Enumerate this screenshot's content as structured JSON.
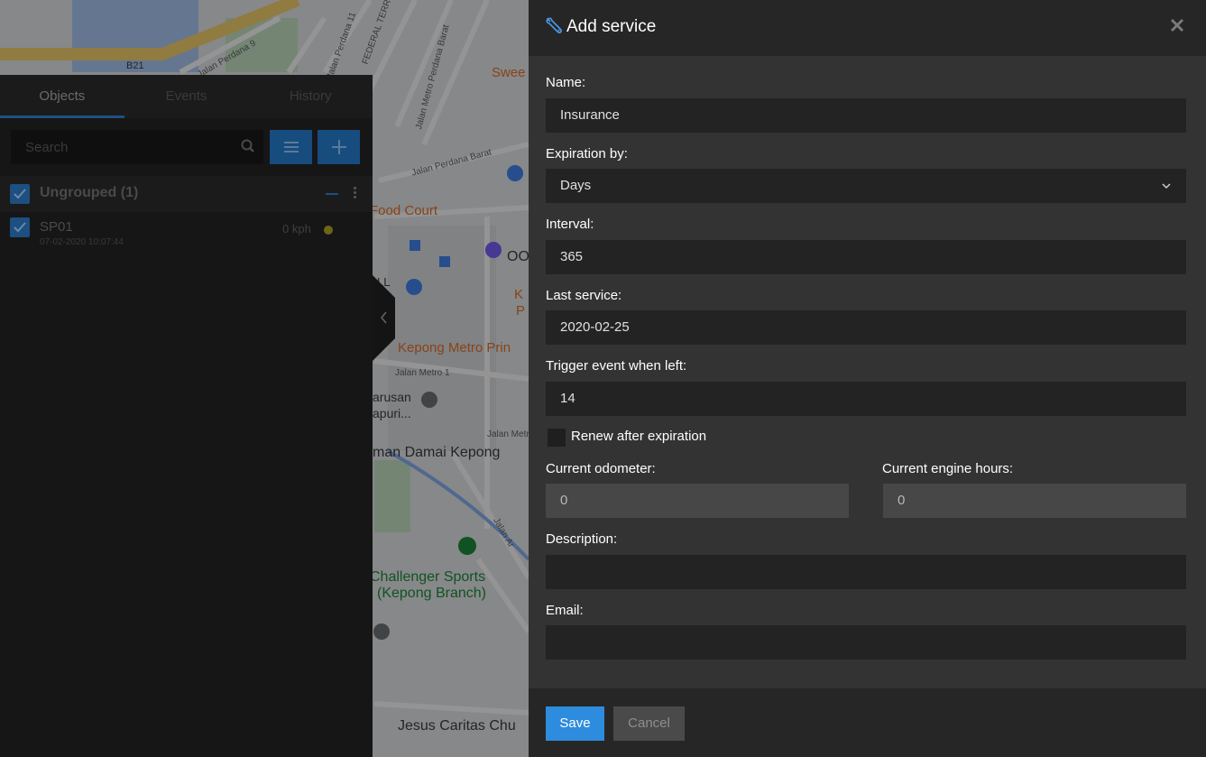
{
  "map": {
    "labels": {
      "road_b21": "B21",
      "perdana9": "Jalan Perdana 9",
      "perdana11": "Jalan Perdana 11",
      "perdana13": "Jalan Perdana 13",
      "federal": "FEDERAL TERR",
      "metro_perdana": "Jalan Metro Perdana Barat",
      "perdana_barat": "Jalan Perdana Barat",
      "sweet": "Swee",
      "food_court": "Food Court",
      "oo": "OO",
      "k": "K",
      "p": "P",
      "ll": "LL",
      "kepong_metro": "Kepong Metro Prin",
      "jalan_metro1": "Jalan Metro 1",
      "jarusan": "arusan",
      "apuri": "apuri...",
      "jalan_metro": "Jalan Metro",
      "taman_damai": "man Damai Kepong",
      "jalan_ar": "Jalan Ar",
      "challenger": "Challenger Sports",
      "kepong_branch": "(Kepong Branch)",
      "jesus": "Jesus Caritas Chu"
    }
  },
  "left_panel": {
    "tabs": [
      "Objects",
      "Events",
      "History"
    ],
    "search_placeholder": "Search",
    "group_label": "Ungrouped (1)",
    "object": {
      "name": "SP01",
      "time": "07-02-2020 10:07:44",
      "speed": "0 kph",
      "status_color": "#e0c020"
    }
  },
  "modal": {
    "title": "Add service",
    "fields": {
      "name": {
        "label": "Name:",
        "value": "Insurance"
      },
      "expiration_by": {
        "label": "Expiration by:",
        "value": "Days"
      },
      "interval": {
        "label": "Interval:",
        "value": "365"
      },
      "last_service": {
        "label": "Last service:",
        "value": "2020-02-25"
      },
      "trigger": {
        "label": "Trigger event when left:",
        "value": "14"
      },
      "renew": {
        "label": "Renew after expiration",
        "checked": false
      },
      "odometer": {
        "label": "Current odometer:",
        "value": "0"
      },
      "engine_hours": {
        "label": "Current engine hours:",
        "value": "0"
      },
      "description": {
        "label": "Description:",
        "value": ""
      },
      "email": {
        "label": "Email:",
        "value": ""
      }
    },
    "buttons": {
      "save": "Save",
      "cancel": "Cancel"
    }
  },
  "colors": {
    "accent": "#2d8cde",
    "modal_bg": "#333333",
    "header_bg": "#262626"
  }
}
